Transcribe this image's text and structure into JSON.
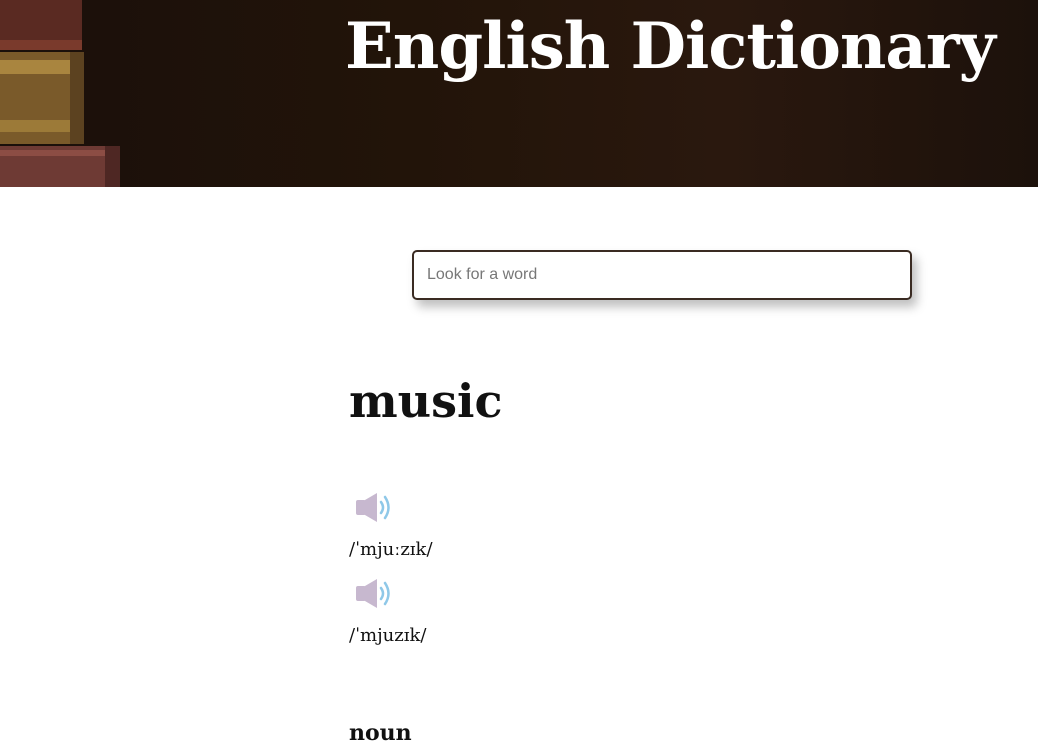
{
  "header": {
    "title": "English Dictionary"
  },
  "search": {
    "placeholder": "Look for a word",
    "value": ""
  },
  "entry": {
    "word": "music",
    "phonetics": [
      {
        "text": "/ˈmjuːzɪk/",
        "icon": "speaker-icon"
      },
      {
        "text": "/ˈmjuzɪk/",
        "icon": "speaker-icon"
      }
    ],
    "part_of_speech": "noun"
  },
  "colors": {
    "header_bg": "#1f130c",
    "title_text": "#ffffff",
    "search_border": "#3a2b22",
    "speaker_body": "#c7b8cf",
    "speaker_waves": "#8fc8e8"
  }
}
